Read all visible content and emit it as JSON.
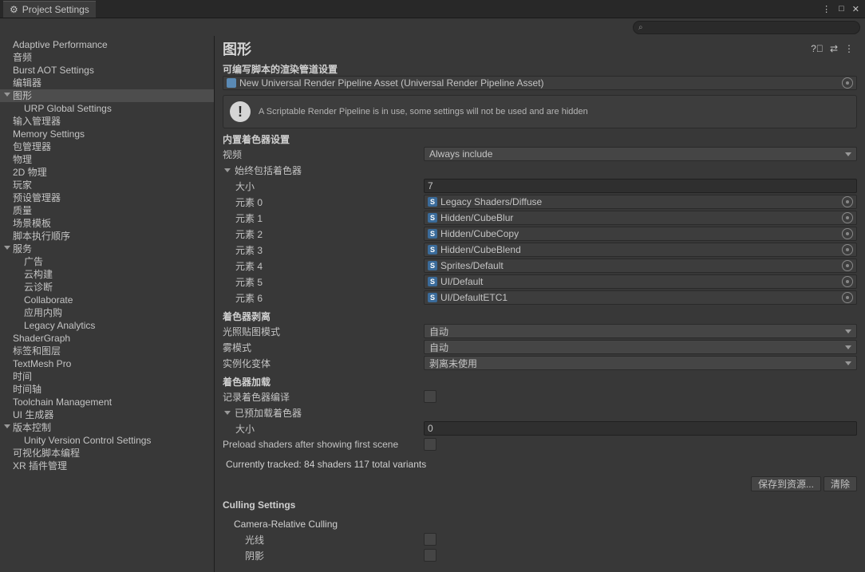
{
  "window": {
    "title": "Project Settings"
  },
  "search": {
    "placeholder": ""
  },
  "sidebar": {
    "items": [
      {
        "label": "Adaptive Performance",
        "indent": 0
      },
      {
        "label": "音频",
        "indent": 0
      },
      {
        "label": "Burst AOT Settings",
        "indent": 0
      },
      {
        "label": "编辑器",
        "indent": 0
      },
      {
        "label": "图形",
        "indent": 0,
        "expandable": true,
        "selected": true
      },
      {
        "label": "URP Global Settings",
        "indent": 1
      },
      {
        "label": "输入管理器",
        "indent": 0
      },
      {
        "label": "Memory Settings",
        "indent": 0
      },
      {
        "label": "包管理器",
        "indent": 0
      },
      {
        "label": "物理",
        "indent": 0
      },
      {
        "label": "2D 物理",
        "indent": 0
      },
      {
        "label": "玩家",
        "indent": 0
      },
      {
        "label": "预设管理器",
        "indent": 0
      },
      {
        "label": "质量",
        "indent": 0
      },
      {
        "label": "场景模板",
        "indent": 0
      },
      {
        "label": "脚本执行顺序",
        "indent": 0
      },
      {
        "label": "服务",
        "indent": 0,
        "expandable": true
      },
      {
        "label": "广告",
        "indent": 1
      },
      {
        "label": "云构建",
        "indent": 1
      },
      {
        "label": "云诊断",
        "indent": 1
      },
      {
        "label": "Collaborate",
        "indent": 1
      },
      {
        "label": "应用内购",
        "indent": 1
      },
      {
        "label": "Legacy Analytics",
        "indent": 1
      },
      {
        "label": "ShaderGraph",
        "indent": 0
      },
      {
        "label": "标签和图层",
        "indent": 0
      },
      {
        "label": "TextMesh Pro",
        "indent": 0
      },
      {
        "label": "时间",
        "indent": 0
      },
      {
        "label": "时间轴",
        "indent": 0
      },
      {
        "label": "Toolchain Management",
        "indent": 0
      },
      {
        "label": "UI 生成器",
        "indent": 0
      },
      {
        "label": "版本控制",
        "indent": 0,
        "expandable": true
      },
      {
        "label": "Unity Version Control Settings",
        "indent": 1
      },
      {
        "label": "可视化脚本编程",
        "indent": 0
      },
      {
        "label": "XR 插件管理",
        "indent": 0
      }
    ]
  },
  "content": {
    "title": "图形",
    "srp_section": "可编写脚本的渲染管道设置",
    "srp_asset": "New Universal Render Pipeline Asset (Universal Render Pipeline Asset)",
    "info": "A Scriptable Render Pipeline is in use, some settings will not be used and are hidden",
    "builtin_section": "内置着色器设置",
    "video_label": "视频",
    "video_value": "Always include",
    "always_include_label": "始终包括着色器",
    "size_label": "大小",
    "size_value": "7",
    "elements": [
      {
        "label": "元素 0",
        "value": "Legacy Shaders/Diffuse"
      },
      {
        "label": "元素 1",
        "value": "Hidden/CubeBlur"
      },
      {
        "label": "元素 2",
        "value": "Hidden/CubeCopy"
      },
      {
        "label": "元素 3",
        "value": "Hidden/CubeBlend"
      },
      {
        "label": "元素 4",
        "value": "Sprites/Default"
      },
      {
        "label": "元素 5",
        "value": "UI/Default"
      },
      {
        "label": "元素 6",
        "value": "UI/DefaultETC1"
      }
    ],
    "stripping_section": "着色器剥离",
    "lightmap_label": "光照贴图模式",
    "lightmap_value": "自动",
    "fog_label": "雾模式",
    "fog_value": "自动",
    "instancing_label": "实例化变体",
    "instancing_value": "剥离未使用",
    "loading_section": "着色器加载",
    "log_label": "记录着色器编译",
    "preloaded_label": "已预加载着色器",
    "preload_size_label": "大小",
    "preload_size_value": "0",
    "preload_after_label": "Preload shaders after showing first scene",
    "tracked": "Currently tracked: 84 shaders 117 total variants",
    "save_btn": "保存到资源...",
    "clear_btn": "清除",
    "culling_section": "Culling Settings",
    "camera_rel": "Camera-Relative Culling",
    "lights_label": "光线",
    "shadows_label": "阴影"
  }
}
